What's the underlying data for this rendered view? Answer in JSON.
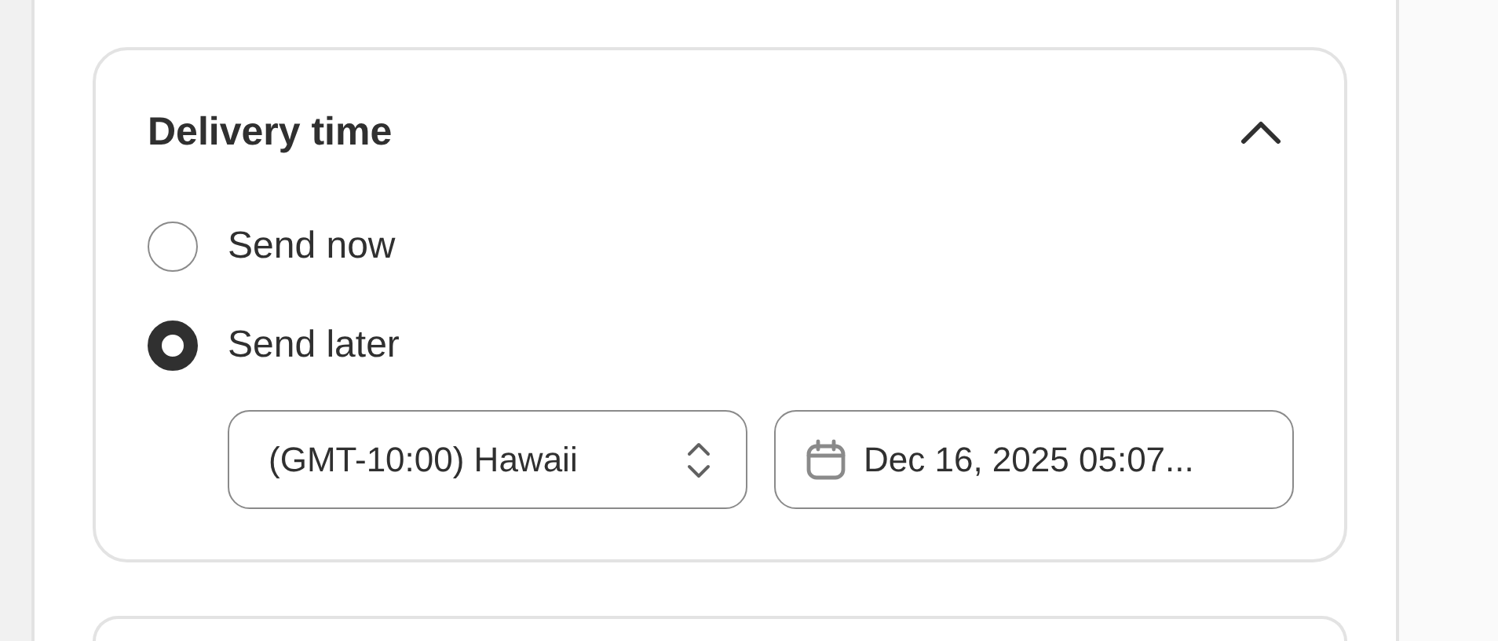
{
  "delivery_time": {
    "title": "Delivery time",
    "expanded": true,
    "options": [
      {
        "label": "Send now",
        "selected": false
      },
      {
        "label": "Send later",
        "selected": true
      }
    ],
    "timezone_select": {
      "value": "(GMT-10:00) Hawaii"
    },
    "datetime_field": {
      "value": "Dec 16, 2025 05:07..."
    }
  }
}
